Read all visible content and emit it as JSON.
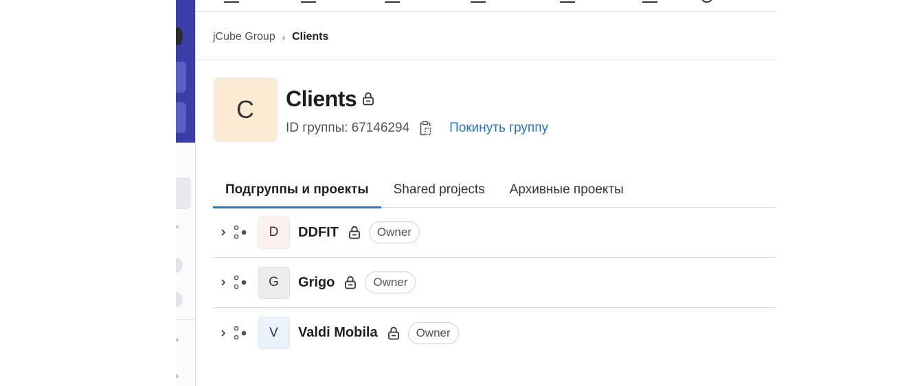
{
  "breadcrumb": {
    "parent": "jCube Group",
    "separator": "›",
    "current": "Clients"
  },
  "group": {
    "avatar_letter": "C",
    "avatar_color": "#fcebd3",
    "name": "Clients",
    "id_label": "ID группы:",
    "id_value": "67146294",
    "leave_label": "Покинуть группу"
  },
  "tabs": [
    {
      "label": "Подгруппы и проекты",
      "active": true
    },
    {
      "label": "Shared projects",
      "active": false
    },
    {
      "label": "Архивные проекты",
      "active": false
    }
  ],
  "items": [
    {
      "letter": "D",
      "name": "DDFIT",
      "badge": "Owner",
      "avatar_color": "#fdf1f0"
    },
    {
      "letter": "G",
      "name": "Grigo",
      "badge": "Owner",
      "avatar_color": "#ececef"
    },
    {
      "letter": "V",
      "name": "Valdi Mobila",
      "badge": "Owner",
      "avatar_color": "#e9f3fc"
    }
  ],
  "colors": {
    "accent": "#1f75cb",
    "sidebar": "#3b3ea6"
  }
}
